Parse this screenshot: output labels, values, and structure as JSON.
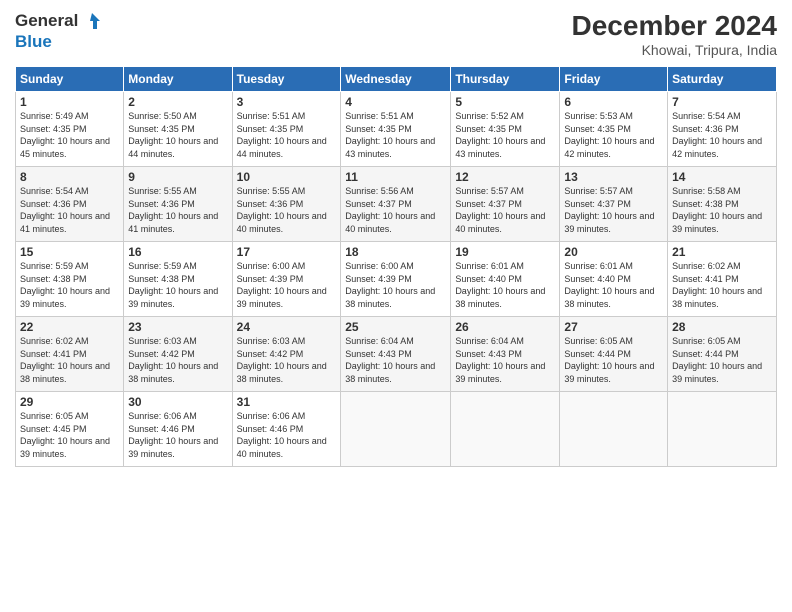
{
  "logo": {
    "line1": "General",
    "line2": "Blue"
  },
  "title": "December 2024",
  "location": "Khowai, Tripura, India",
  "days_of_week": [
    "Sunday",
    "Monday",
    "Tuesday",
    "Wednesday",
    "Thursday",
    "Friday",
    "Saturday"
  ],
  "weeks": [
    [
      {
        "day": "1",
        "sunrise": "5:49 AM",
        "sunset": "4:35 PM",
        "daylight": "10 hours and 45 minutes."
      },
      {
        "day": "2",
        "sunrise": "5:50 AM",
        "sunset": "4:35 PM",
        "daylight": "10 hours and 44 minutes."
      },
      {
        "day": "3",
        "sunrise": "5:51 AM",
        "sunset": "4:35 PM",
        "daylight": "10 hours and 44 minutes."
      },
      {
        "day": "4",
        "sunrise": "5:51 AM",
        "sunset": "4:35 PM",
        "daylight": "10 hours and 43 minutes."
      },
      {
        "day": "5",
        "sunrise": "5:52 AM",
        "sunset": "4:35 PM",
        "daylight": "10 hours and 43 minutes."
      },
      {
        "day": "6",
        "sunrise": "5:53 AM",
        "sunset": "4:35 PM",
        "daylight": "10 hours and 42 minutes."
      },
      {
        "day": "7",
        "sunrise": "5:54 AM",
        "sunset": "4:36 PM",
        "daylight": "10 hours and 42 minutes."
      }
    ],
    [
      {
        "day": "8",
        "sunrise": "5:54 AM",
        "sunset": "4:36 PM",
        "daylight": "10 hours and 41 minutes."
      },
      {
        "day": "9",
        "sunrise": "5:55 AM",
        "sunset": "4:36 PM",
        "daylight": "10 hours and 41 minutes."
      },
      {
        "day": "10",
        "sunrise": "5:55 AM",
        "sunset": "4:36 PM",
        "daylight": "10 hours and 40 minutes."
      },
      {
        "day": "11",
        "sunrise": "5:56 AM",
        "sunset": "4:37 PM",
        "daylight": "10 hours and 40 minutes."
      },
      {
        "day": "12",
        "sunrise": "5:57 AM",
        "sunset": "4:37 PM",
        "daylight": "10 hours and 40 minutes."
      },
      {
        "day": "13",
        "sunrise": "5:57 AM",
        "sunset": "4:37 PM",
        "daylight": "10 hours and 39 minutes."
      },
      {
        "day": "14",
        "sunrise": "5:58 AM",
        "sunset": "4:38 PM",
        "daylight": "10 hours and 39 minutes."
      }
    ],
    [
      {
        "day": "15",
        "sunrise": "5:59 AM",
        "sunset": "4:38 PM",
        "daylight": "10 hours and 39 minutes."
      },
      {
        "day": "16",
        "sunrise": "5:59 AM",
        "sunset": "4:38 PM",
        "daylight": "10 hours and 39 minutes."
      },
      {
        "day": "17",
        "sunrise": "6:00 AM",
        "sunset": "4:39 PM",
        "daylight": "10 hours and 39 minutes."
      },
      {
        "day": "18",
        "sunrise": "6:00 AM",
        "sunset": "4:39 PM",
        "daylight": "10 hours and 38 minutes."
      },
      {
        "day": "19",
        "sunrise": "6:01 AM",
        "sunset": "4:40 PM",
        "daylight": "10 hours and 38 minutes."
      },
      {
        "day": "20",
        "sunrise": "6:01 AM",
        "sunset": "4:40 PM",
        "daylight": "10 hours and 38 minutes."
      },
      {
        "day": "21",
        "sunrise": "6:02 AM",
        "sunset": "4:41 PM",
        "daylight": "10 hours and 38 minutes."
      }
    ],
    [
      {
        "day": "22",
        "sunrise": "6:02 AM",
        "sunset": "4:41 PM",
        "daylight": "10 hours and 38 minutes."
      },
      {
        "day": "23",
        "sunrise": "6:03 AM",
        "sunset": "4:42 PM",
        "daylight": "10 hours and 38 minutes."
      },
      {
        "day": "24",
        "sunrise": "6:03 AM",
        "sunset": "4:42 PM",
        "daylight": "10 hours and 38 minutes."
      },
      {
        "day": "25",
        "sunrise": "6:04 AM",
        "sunset": "4:43 PM",
        "daylight": "10 hours and 38 minutes."
      },
      {
        "day": "26",
        "sunrise": "6:04 AM",
        "sunset": "4:43 PM",
        "daylight": "10 hours and 39 minutes."
      },
      {
        "day": "27",
        "sunrise": "6:05 AM",
        "sunset": "4:44 PM",
        "daylight": "10 hours and 39 minutes."
      },
      {
        "day": "28",
        "sunrise": "6:05 AM",
        "sunset": "4:44 PM",
        "daylight": "10 hours and 39 minutes."
      }
    ],
    [
      {
        "day": "29",
        "sunrise": "6:05 AM",
        "sunset": "4:45 PM",
        "daylight": "10 hours and 39 minutes."
      },
      {
        "day": "30",
        "sunrise": "6:06 AM",
        "sunset": "4:46 PM",
        "daylight": "10 hours and 39 minutes."
      },
      {
        "day": "31",
        "sunrise": "6:06 AM",
        "sunset": "4:46 PM",
        "daylight": "10 hours and 40 minutes."
      },
      null,
      null,
      null,
      null
    ]
  ],
  "labels": {
    "sunrise_prefix": "Sunrise: ",
    "sunset_prefix": "Sunset: ",
    "daylight_prefix": "Daylight: "
  }
}
